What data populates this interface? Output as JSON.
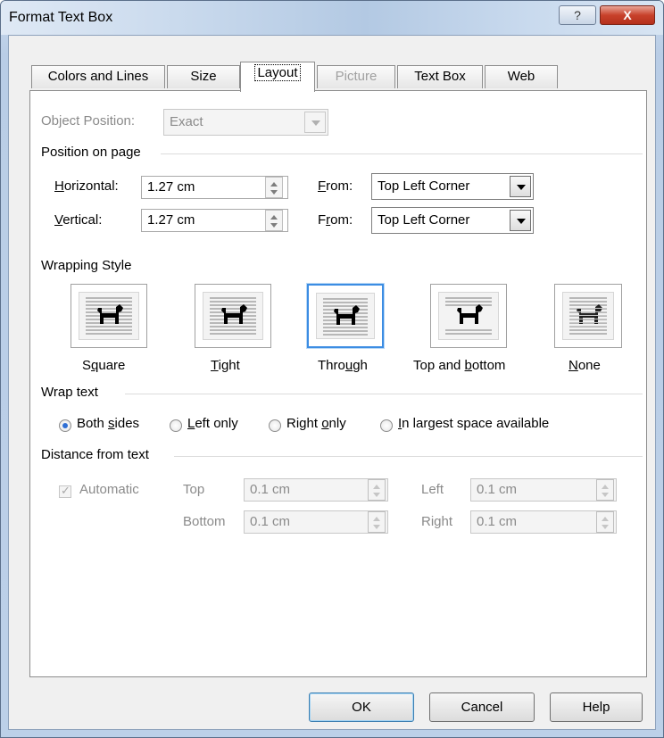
{
  "window": {
    "title": "Format Text Box",
    "help_glyph": "?",
    "close_glyph": "X"
  },
  "tabs": [
    {
      "label": "Colors and Lines",
      "state": "normal"
    },
    {
      "label": "Size",
      "state": "normal"
    },
    {
      "label": "Layout",
      "state": "active"
    },
    {
      "label": "Picture",
      "state": "disabled"
    },
    {
      "label": "Text Box",
      "state": "normal"
    },
    {
      "label": "Web",
      "state": "normal"
    }
  ],
  "object_position": {
    "label": "Object Position:",
    "value": "Exact"
  },
  "position_on_page": {
    "heading": "Position on page",
    "horizontal": {
      "label_ul": "H",
      "label_rest": "orizontal:",
      "value": "1.27 cm",
      "from_ul": "F",
      "from_rest": "rom:",
      "from_value": "Top Left Corner"
    },
    "vertical": {
      "label_ul": "V",
      "label_rest": "ertical:",
      "value": "1.27 cm",
      "from_pre": "F",
      "from_ul": "r",
      "from_rest": "om:",
      "from_value": "Top Left Corner"
    }
  },
  "wrapping_style": {
    "heading": "Wrapping Style",
    "options": [
      {
        "pre": "S",
        "ul": "q",
        "post": "uare"
      },
      {
        "pre": "",
        "ul": "T",
        "post": "ight"
      },
      {
        "pre": "Thro",
        "ul": "u",
        "post": "gh"
      },
      {
        "pre": "Top and ",
        "ul": "b",
        "post": "ottom"
      },
      {
        "pre": "",
        "ul": "N",
        "post": "one"
      }
    ],
    "selected": "Through"
  },
  "wrap_text": {
    "heading": "Wrap text",
    "options": [
      {
        "pre": "Both ",
        "ul": "s",
        "post": "ides"
      },
      {
        "pre": "",
        "ul": "L",
        "post": "eft only"
      },
      {
        "pre": "Right ",
        "ul": "o",
        "post": "nly"
      },
      {
        "pre": "",
        "ul": "I",
        "post": "n largest space available"
      }
    ],
    "selected": "Both sides"
  },
  "distance_from_text": {
    "heading": "Distance from text",
    "automatic": "Automatic",
    "top": {
      "label": "Top",
      "value": "0.1 cm"
    },
    "bottom": {
      "label": "Bottom",
      "value": "0.1 cm"
    },
    "left": {
      "label": "Left",
      "value": "0.1 cm"
    },
    "right": {
      "label": "Right",
      "value": "0.1 cm"
    }
  },
  "buttons": {
    "ok": "OK",
    "cancel": "Cancel",
    "help": "Help"
  },
  "colors": {
    "selected_border": "#3c8de3",
    "radio_dot": "#2e6ed4"
  }
}
